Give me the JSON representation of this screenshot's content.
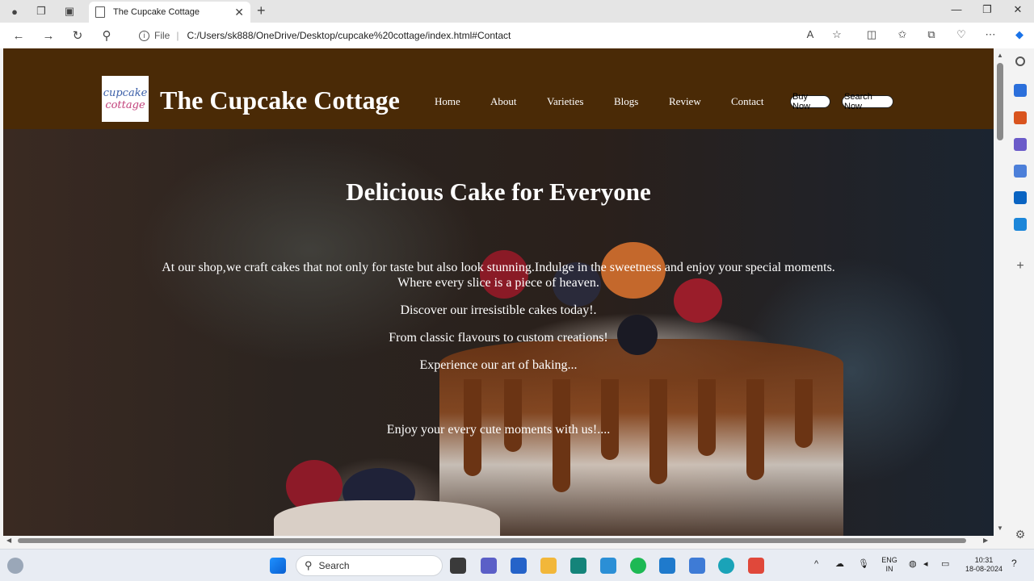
{
  "browser": {
    "tab_title": "The Cupcake Cottage",
    "new_tab_label": "+",
    "address_prefix": "File",
    "url": "C:/Users/sk888/OneDrive/Desktop/cupcake%20cottage/index.html#Contact"
  },
  "site": {
    "logo_line1": "cupcake",
    "logo_line2": "cottage",
    "title": "The Cupcake Cottage",
    "nav": [
      "Home",
      "About",
      "Varieties",
      "Blogs",
      "Review",
      "Contact"
    ],
    "buy_button": "Buy Now",
    "search_button": "Search Now"
  },
  "hero": {
    "heading": "Delicious Cake for Everyone",
    "paragraph_line1": "At our shop,we craft cakes that not only for taste but also look stunning.Indulge in the sweetness and enjoy your special moments.",
    "paragraph_line2": "Where every slice is a piece of heaven.",
    "line3": "Discover our irresistible cakes today!.",
    "line4": "From classic flavours to custom creations!",
    "line5": "Experience our art of baking...",
    "line6": "Enjoy your every cute moments with us!...."
  },
  "taskbar": {
    "search_label": "Search",
    "lang_line1": "ENG",
    "lang_line2": "IN",
    "time": "10:31",
    "date": "18-08-2024"
  },
  "colors": {
    "header_bg": "#4a2a06",
    "text": "#ffffff"
  }
}
